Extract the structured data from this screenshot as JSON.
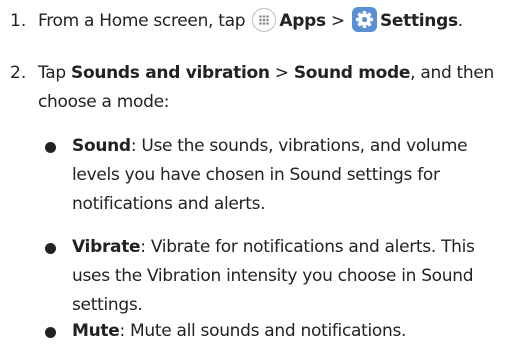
{
  "steps": [
    {
      "number": "1.",
      "text_before": "From a Home screen, tap",
      "apps_label": "Apps",
      "separator": ">",
      "settings_label": "Settings",
      "end": "."
    },
    {
      "number": "2.",
      "text_tap": "Tap",
      "sounds_label": "Sounds and vibration",
      "separator": ">",
      "sound_mode_label": "Sound mode",
      "text_after": ", and then",
      "line2": "choose a mode:"
    }
  ],
  "modes": [
    {
      "label": "Sound",
      "desc_line1": ": Use the sounds, vibrations, and volume",
      "desc_line2": "levels you have chosen in Sound settings for",
      "desc_line3": "notifications and alerts."
    },
    {
      "label": "Vibrate",
      "desc_line1": ": Vibrate for notifications and alerts. This",
      "desc_line2": "uses the Vibration intensity you choose in Sound",
      "desc_line3": "settings."
    },
    {
      "label": "Mute",
      "desc_line1": ": Mute all sounds and notifications."
    }
  ],
  "icons": {
    "apps": "apps-grid-icon",
    "settings": "gear-icon",
    "settings_color": "#5a8fd6"
  }
}
